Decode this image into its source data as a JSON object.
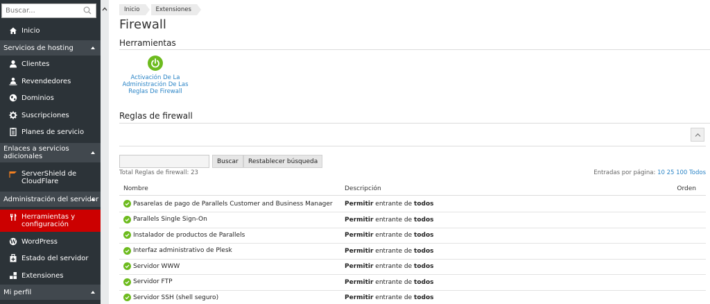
{
  "sidebar": {
    "search_placeholder": "Buscar...",
    "inicio": "Inicio",
    "sections": {
      "hosting": "Servicios de hosting",
      "enlaces": "Enlaces a servicios adicionales",
      "admin": "Administración del servidor",
      "perfil": "Mi perfil"
    },
    "items": {
      "clientes": "Clientes",
      "revendedores": "Revendedores",
      "dominios": "Dominios",
      "suscripciones": "Suscripciones",
      "planes": "Planes de servicio",
      "servershield": "ServerShield de CloudFlare",
      "herramientas": "Herramientas y configuración",
      "wordpress": "WordPress",
      "estado": "Estado del servidor",
      "extensiones": "Extensiones"
    },
    "accent_active": "#cc0000"
  },
  "breadcrumb": [
    "Inicio",
    "Extensiones"
  ],
  "page_title": "Firewall",
  "tools_section": {
    "title": "Herramientas",
    "tool_label": "Activación De La Administración De Las Reglas De Firewall"
  },
  "rules_section": {
    "title": "Reglas de firewall",
    "search_button": "Buscar",
    "reset_button": "Restablecer búsqueda",
    "total": "Total Reglas de firewall: 23",
    "perpage_label": "Entradas por página:",
    "perpage_options": "10 25 100 Todos",
    "columns": {
      "name": "Nombre",
      "description": "Descripción",
      "order": "Orden"
    },
    "desc_parts": {
      "verb": "Permitir",
      "middle": " entrante de ",
      "who": "todos"
    },
    "rows": [
      "Pasarelas de pago de Parallels Customer and Business Manager",
      "Parallels Single Sign-On",
      "Instalador de productos de Parallels",
      "Interfaz administrativo de Plesk",
      "Servidor WWW",
      "Servidor FTP",
      "Servidor SSH (shell seguro)"
    ]
  }
}
